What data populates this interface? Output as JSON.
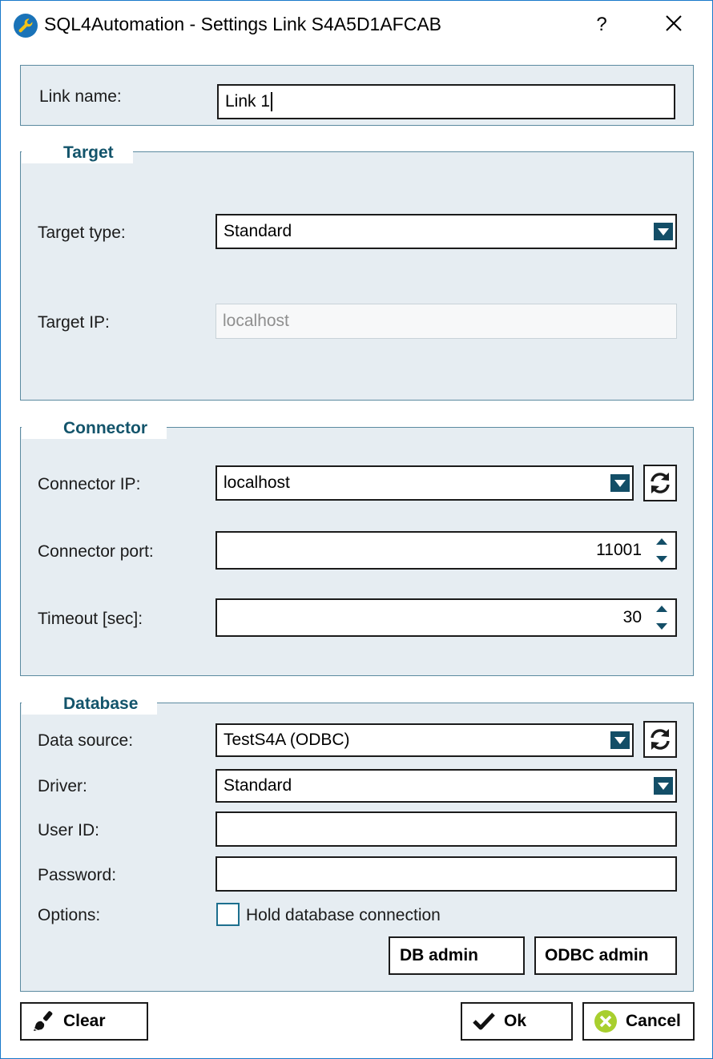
{
  "window": {
    "title": "SQL4Automation - Settings Link S4A5D1AFCAB",
    "help_label": "?",
    "icon": "wrench-icon",
    "close_icon": "close-icon"
  },
  "link": {
    "label": "Link name:",
    "value": "Link 1"
  },
  "target": {
    "legend": "Target",
    "type_label": "Target type:",
    "type_value": "Standard",
    "ip_label": "Target IP:",
    "ip_placeholder": "localhost"
  },
  "connector": {
    "legend": "Connector",
    "ip_label": "Connector IP:",
    "ip_value": "localhost",
    "port_label": "Connector port:",
    "port_value": "11001",
    "timeout_label": "Timeout [sec]:",
    "timeout_value": "30"
  },
  "database": {
    "legend": "Database",
    "source_label": "Data source:",
    "source_value": "TestS4A (ODBC)",
    "driver_label": "Driver:",
    "driver_value": "Standard",
    "user_label": "User ID:",
    "user_value": "",
    "password_label": "Password:",
    "password_value": "",
    "options_label": "Options:",
    "hold_label": "Hold database connection",
    "hold_checked": false,
    "db_admin_label": "DB admin",
    "odbc_admin_label": "ODBC admin"
  },
  "footer": {
    "clear_label": "Clear",
    "ok_label": "Ok",
    "cancel_label": "Cancel"
  },
  "colors": {
    "panel_bg": "#e6edf2",
    "panel_border": "#5b8aa0",
    "legend_text": "#13546b",
    "dropdown_button": "#134e67",
    "cancel_icon": "#a8cf2e"
  }
}
